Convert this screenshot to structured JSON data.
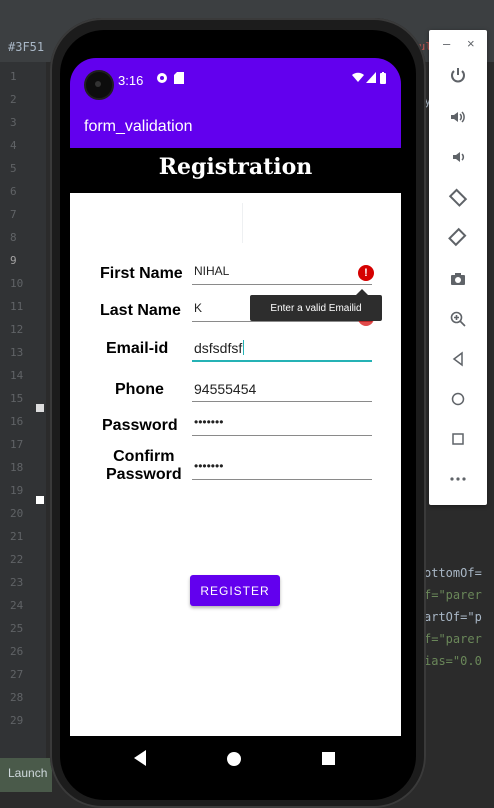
{
  "ide": {
    "tab_text": "#3F51",
    "status_text": "sult",
    "line_numbers": [
      "1",
      "2",
      "3",
      "4",
      "5",
      "6",
      "7",
      "8",
      "9",
      "10",
      "11",
      "12",
      "13",
      "14",
      "15",
      "16",
      "17",
      "18",
      "19",
      "20",
      "21",
      "22",
      "23",
      "24",
      "25",
      "26",
      "27",
      "28",
      "29"
    ],
    "current_line": "9",
    "launch_tab": "Launch",
    "code_snippets": {
      "l2": "y",
      "l22": "ottomOf=",
      "l23": "f=\"parer",
      "l24": "artOf=\"p",
      "l25": "f=\"parer",
      "l26": "ias=\"0.0"
    }
  },
  "emulator_toolbar": {
    "minimize": "–",
    "close": "×",
    "buttons": [
      "power-icon",
      "volume-up-icon",
      "volume-down-icon",
      "rotate-left-icon",
      "rotate-right-icon",
      "camera-icon",
      "zoom-icon",
      "back-icon",
      "home-icon",
      "overview-icon",
      "more-icon"
    ]
  },
  "status_bar": {
    "time": "3:16",
    "color": "#6200ee"
  },
  "app_bar": {
    "title": "form_validation"
  },
  "form": {
    "heading": "Registration",
    "first_name_label": "First Name",
    "first_name_value": "NIHAL",
    "last_name_label": "Last Name",
    "last_name_value": "K",
    "email_label": "Email-id",
    "email_value": "dsfsdfsf",
    "email_error": "Enter a valid Emailid",
    "phone_label": "Phone",
    "phone_value": "94555454",
    "password_label": "Password",
    "password_value": "•••••••",
    "confirm_label_line1": "Confirm",
    "confirm_label_line2": "Password",
    "confirm_value": "•••••••",
    "register_button": "REGISTER"
  },
  "colors": {
    "primary": "#6200ee",
    "accent": "#25b2b5",
    "error": "#d50000"
  }
}
